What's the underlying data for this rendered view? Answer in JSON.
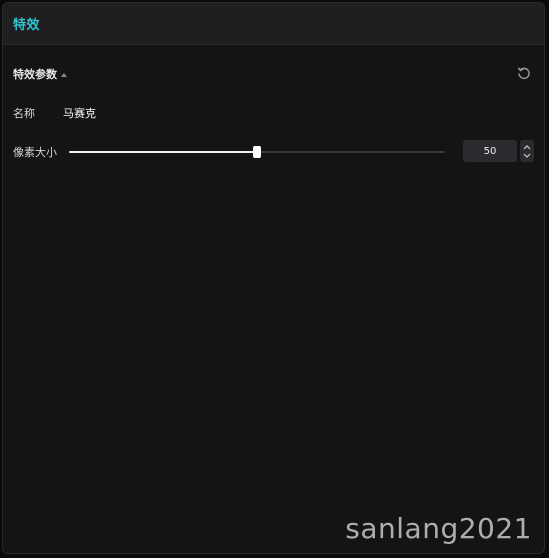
{
  "header": {
    "title": "特效"
  },
  "section": {
    "title": "特效参数",
    "reset_icon": "reset-icon"
  },
  "name_row": {
    "label": "名称",
    "value": "马赛克"
  },
  "size_row": {
    "label": "像素大小",
    "value": "50",
    "slider_fraction": 0.5
  },
  "watermark": "sanlang2021",
  "colors": {
    "accent": "#33c4d1",
    "panel_bg": "#141415",
    "header_bg": "#1f1f22"
  }
}
